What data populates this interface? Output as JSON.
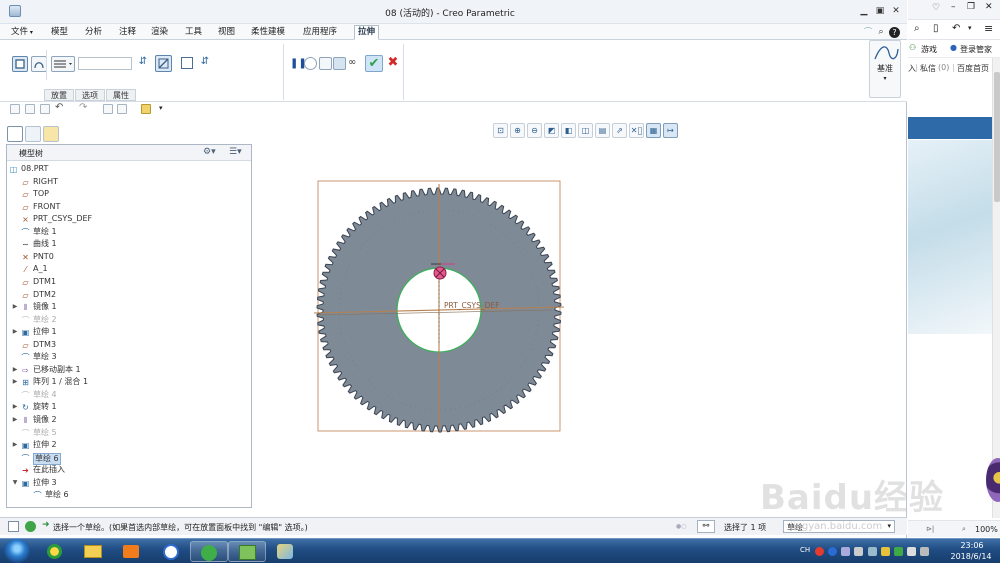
{
  "window": {
    "title": "08 (活动的) - Creo Parametric"
  },
  "menu": {
    "tabs": [
      {
        "label": "文件",
        "dropdown": true
      },
      {
        "label": "模型"
      },
      {
        "label": "分析"
      },
      {
        "label": "注释"
      },
      {
        "label": "渲染"
      },
      {
        "label": "工具"
      },
      {
        "label": "视图"
      },
      {
        "label": "柔性建模"
      },
      {
        "label": "应用程序"
      },
      {
        "label": "拉伸",
        "active": true
      }
    ]
  },
  "ribbon": {
    "subtabs": [
      "放置",
      "选项",
      "属性"
    ],
    "datum_label": "基准",
    "depth_value": ""
  },
  "model_tree": {
    "header": "模型树",
    "items": [
      {
        "label": "08.PRT",
        "icon": "part-icon",
        "level": 0
      },
      {
        "label": "RIGHT",
        "icon": "datum-plane-icon",
        "level": 1
      },
      {
        "label": "TOP",
        "icon": "datum-plane-icon",
        "level": 1
      },
      {
        "label": "FRONT",
        "icon": "datum-plane-icon",
        "level": 1
      },
      {
        "label": "PRT_CSYS_DEF",
        "icon": "csys-icon",
        "level": 1
      },
      {
        "label": "草绘 1",
        "icon": "sketch-icon",
        "level": 1
      },
      {
        "label": "曲线 1",
        "icon": "curve-icon",
        "level": 1
      },
      {
        "label": "PNT0",
        "icon": "datum-point-icon",
        "level": 1
      },
      {
        "label": "A_1",
        "icon": "axis-icon",
        "level": 1
      },
      {
        "label": "DTM1",
        "icon": "datum-plane-icon",
        "level": 1
      },
      {
        "label": "DTM2",
        "icon": "datum-plane-icon",
        "level": 1
      },
      {
        "label": "镜像 1",
        "icon": "mirror-icon",
        "level": 1,
        "expandable": true
      },
      {
        "label": "草绘 2",
        "icon": "sketch-icon",
        "level": 1,
        "dim": true
      },
      {
        "label": "拉伸 1",
        "icon": "extrude-icon",
        "level": 1,
        "expandable": true
      },
      {
        "label": "DTM3",
        "icon": "datum-plane-icon",
        "level": 1
      },
      {
        "label": "草绘 3",
        "icon": "sketch-icon",
        "level": 1
      },
      {
        "label": "已移动副本 1",
        "icon": "move-copy-icon",
        "level": 1,
        "expandable": true
      },
      {
        "label": "阵列 1 / 混合 1",
        "icon": "pattern-icon",
        "level": 1,
        "expandable": true
      },
      {
        "label": "草绘 4",
        "icon": "sketch-icon",
        "level": 1,
        "dim": true
      },
      {
        "label": "旋转 1",
        "icon": "revolve-icon",
        "level": 1,
        "expandable": true
      },
      {
        "label": "镜像 2",
        "icon": "mirror-icon",
        "level": 1,
        "expandable": true
      },
      {
        "label": "草绘 5",
        "icon": "sketch-icon",
        "level": 1,
        "dim": true
      },
      {
        "label": "拉伸 2",
        "icon": "extrude-icon",
        "level": 1,
        "expandable": true
      },
      {
        "label": "草绘 6",
        "icon": "sketch-icon",
        "level": 1,
        "highlight": true
      },
      {
        "label": "在此插入",
        "icon": "insert-arrow-icon",
        "level": 1
      },
      {
        "label": "拉伸 3",
        "icon": "extrude-icon",
        "level": 1,
        "expanded": true
      },
      {
        "label": "草绘 6",
        "icon": "sketch-icon",
        "level": 2
      }
    ]
  },
  "graphics": {
    "csys_label": "PRT_CSYS_DEF"
  },
  "statusbar": {
    "message": "选择一个草绘。(如果首选内部草绘，可在放置面板中找到 \"编辑\" 选项。)",
    "selected": "选择了 1 项",
    "filter": "草绘"
  },
  "browser": {
    "games_label": "游戏",
    "login_label": "登录管家",
    "link_in": "入",
    "link_pm": "私信",
    "pm_count": "(0)",
    "link_home": "百度首页",
    "zoom": "100%"
  },
  "taskbar": {
    "time": "23:06",
    "date": "2018/6/14",
    "lang": "CH"
  },
  "watermark": {
    "text": "Baidu经验",
    "url": "jingyan.baidu.com"
  },
  "colors": {
    "gear": "#7f8a97",
    "gear_edge": "#3c4452",
    "bore_edge": "#3bb05a",
    "frame": "#c48b60",
    "csys_point": "#e05a8b",
    "confirm": "#2fa24a",
    "cancel": "#d22a2a"
  }
}
